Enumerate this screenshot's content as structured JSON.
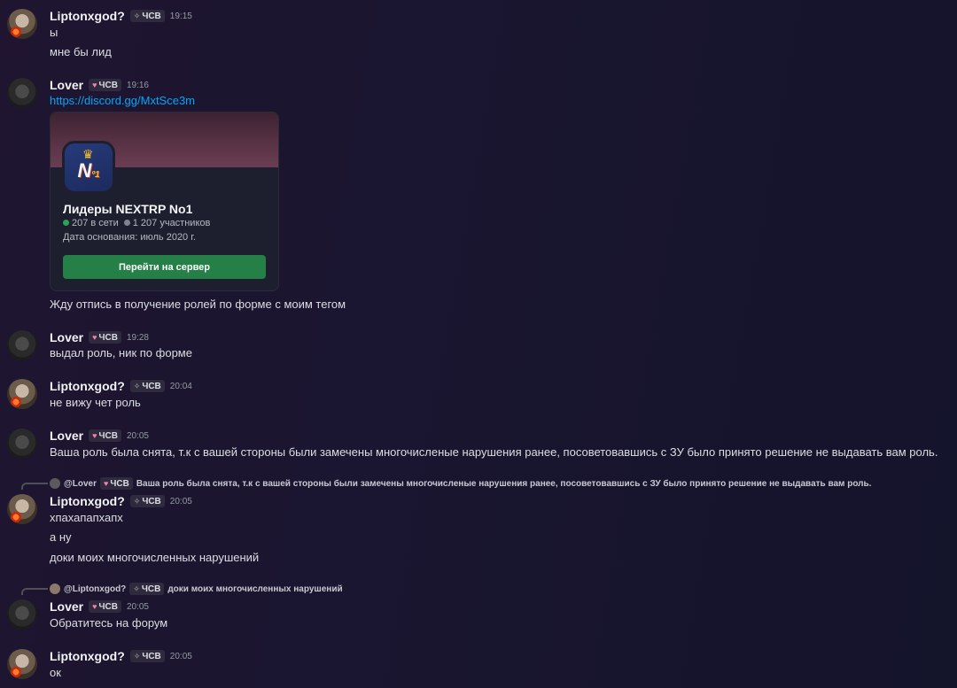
{
  "colors": {
    "background": "#1a1530",
    "link": "#00a8fc",
    "join_button": "#248046",
    "online": "#23a55a",
    "members": "#80848e",
    "tag_heart": "#f47fb2"
  },
  "tags": {
    "lipton": {
      "icon": "sparkle-icon",
      "label": "ЧСВ"
    },
    "lover": {
      "icon": "heart-icon",
      "label": "ЧСВ"
    }
  },
  "messages": [
    {
      "author": "Liptonxgod?",
      "time": "19:15",
      "lines": [
        "ы",
        "мне бы лид"
      ]
    },
    {
      "author": "Lover",
      "time": "19:16",
      "link": "https://discord.gg/MxtSce3m",
      "after_embed": "Жду отпись в получение ролей по форме с моим тегом"
    },
    {
      "author": "Lover",
      "time": "19:28",
      "lines": [
        "выдал роль, ник по форме"
      ]
    },
    {
      "author": "Liptonxgod?",
      "time": "20:04",
      "lines": [
        "не вижу чет роль"
      ]
    },
    {
      "author": "Lover",
      "time": "20:05",
      "lines": [
        "Ваша роль была снята, т.к с вашей стороны были замечены многочисленые нарушения ранее, посоветовавшись с ЗУ было принято решение не выдавать вам роль."
      ]
    },
    {
      "author": "Liptonxgod?",
      "time": "20:05",
      "reply": {
        "name": "@Lover",
        "text": "Ваша роль была снята, т.к с вашей стороны были замечены многочисленые нарушения ранее, посоветовавшись с ЗУ было принято решение не выдавать вам роль."
      },
      "lines": [
        "хпахапапхапх",
        "а ну",
        "доки моих многочисленных нарушений"
      ]
    },
    {
      "author": "Lover",
      "time": "20:05",
      "reply": {
        "name": "@Liptonxgod?",
        "text": "доки моих многочисленных нарушений"
      },
      "lines": [
        "Обратитесь на форум"
      ]
    },
    {
      "author": "Liptonxgod?",
      "time": "20:05",
      "lines": [
        "ок"
      ]
    }
  ],
  "invite": {
    "server_name": "Лидеры NEXTRP No1",
    "online": "207 в сети",
    "members": "1 207 участников",
    "founded": "Дата основания: июль 2020 г.",
    "button": "Перейти на сервер",
    "icon_label": "N",
    "icon_sub": "º1"
  }
}
